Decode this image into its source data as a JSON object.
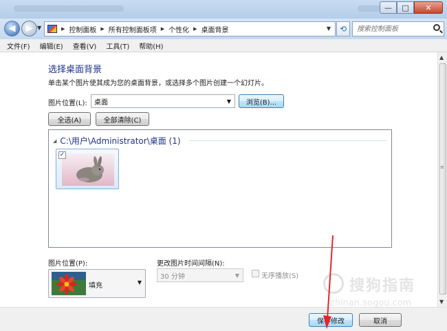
{
  "window": {
    "minimize_glyph": "—",
    "maximize_glyph": "□",
    "close_glyph": "✕"
  },
  "address": {
    "crumbs": [
      "控制面板",
      "所有控制面板项",
      "个性化",
      "桌面背景"
    ],
    "search_placeholder": "搜索控制面板"
  },
  "menu": [
    "文件(F)",
    "编辑(E)",
    "查看(V)",
    "工具(T)",
    "帮助(H)"
  ],
  "page": {
    "title": "选择桌面背景",
    "subtitle": "单击某个图片使其成为您的桌面背景，或选择多个图片创建一个幻灯片。",
    "location_label": "图片位置(L):",
    "location_value": "桌面",
    "browse_button": "浏览(B)...",
    "select_all_button": "全选(A)",
    "clear_all_button": "全部清除(C)"
  },
  "gallery": {
    "group_title": "C:\\用户\\Administrator\\桌面 (1)",
    "items": [
      {
        "checked": true,
        "check_glyph": "✓",
        "icon": "rabbit-image"
      }
    ]
  },
  "options": {
    "position_label": "图片位置(P):",
    "position_value": "填充",
    "interval_label": "更改图片时间间隔(N):",
    "interval_value": "30 分钟",
    "shuffle_label": "无序播放(S)"
  },
  "footer": {
    "save_button": "保存修改",
    "cancel_button": "取消"
  },
  "watermark": {
    "text": "搜狗指南",
    "url": "zhinan.sogou.com"
  },
  "colors": {
    "heading": "#1e3287",
    "annotation_arrow": "#e8242a"
  }
}
